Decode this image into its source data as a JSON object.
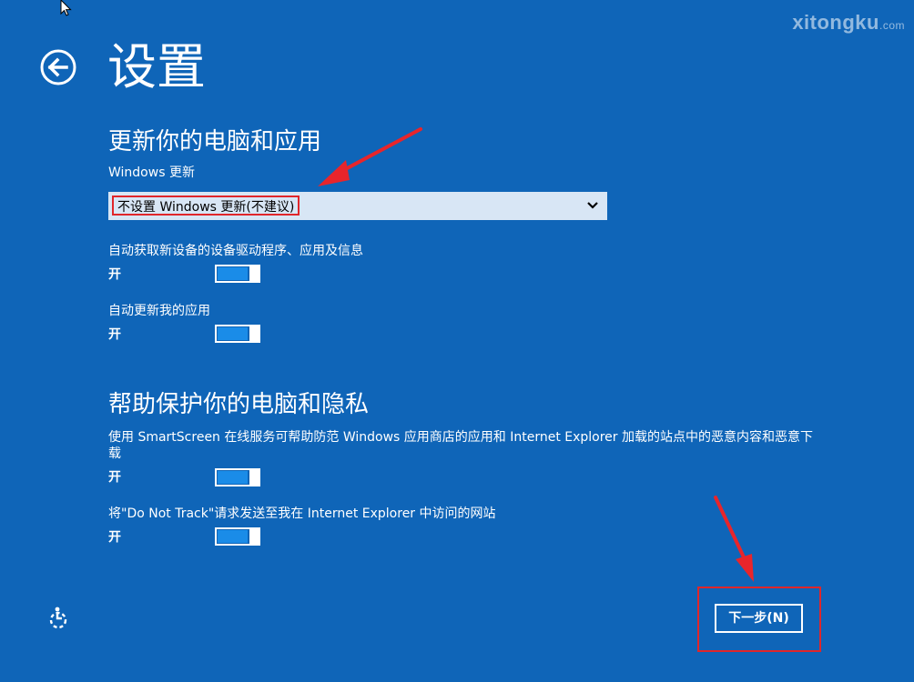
{
  "watermark": {
    "brand": "xitongku",
    "suffix": ".com"
  },
  "header": {
    "title": "设置"
  },
  "sections": {
    "updates": {
      "title": "更新你的电脑和应用",
      "windows_update_label": "Windows 更新",
      "windows_update_selected": "不设置 Windows 更新(不建议)",
      "driver_label": "自动获取新设备的设备驱动程序、应用及信息",
      "driver_state": "开",
      "driver_on": true,
      "apps_label": "自动更新我的应用",
      "apps_state": "开",
      "apps_on": true
    },
    "privacy": {
      "title": "帮助保护你的电脑和隐私",
      "smartscreen_label": "使用 SmartScreen 在线服务可帮助防范 Windows 应用商店的应用和 Internet Explorer 加载的站点中的恶意内容和恶意下载",
      "smartscreen_state": "开",
      "smartscreen_on": true,
      "dnt_label": "将\"Do Not Track\"请求发送至我在 Internet Explorer 中访问的网站",
      "dnt_state": "开",
      "dnt_on": true
    }
  },
  "footer": {
    "next_label": "下一步(N)"
  },
  "colors": {
    "background": "#0f65b8",
    "toggle_fill": "#1a8ce8",
    "highlight": "#e0262a",
    "dropdown_bg": "#d8e6f5"
  },
  "icons": {
    "back": "back-arrow-circle-icon",
    "chevron": "chevron-down-icon",
    "accessibility": "ease-of-access-icon",
    "cursor": "mouse-pointer-icon"
  }
}
